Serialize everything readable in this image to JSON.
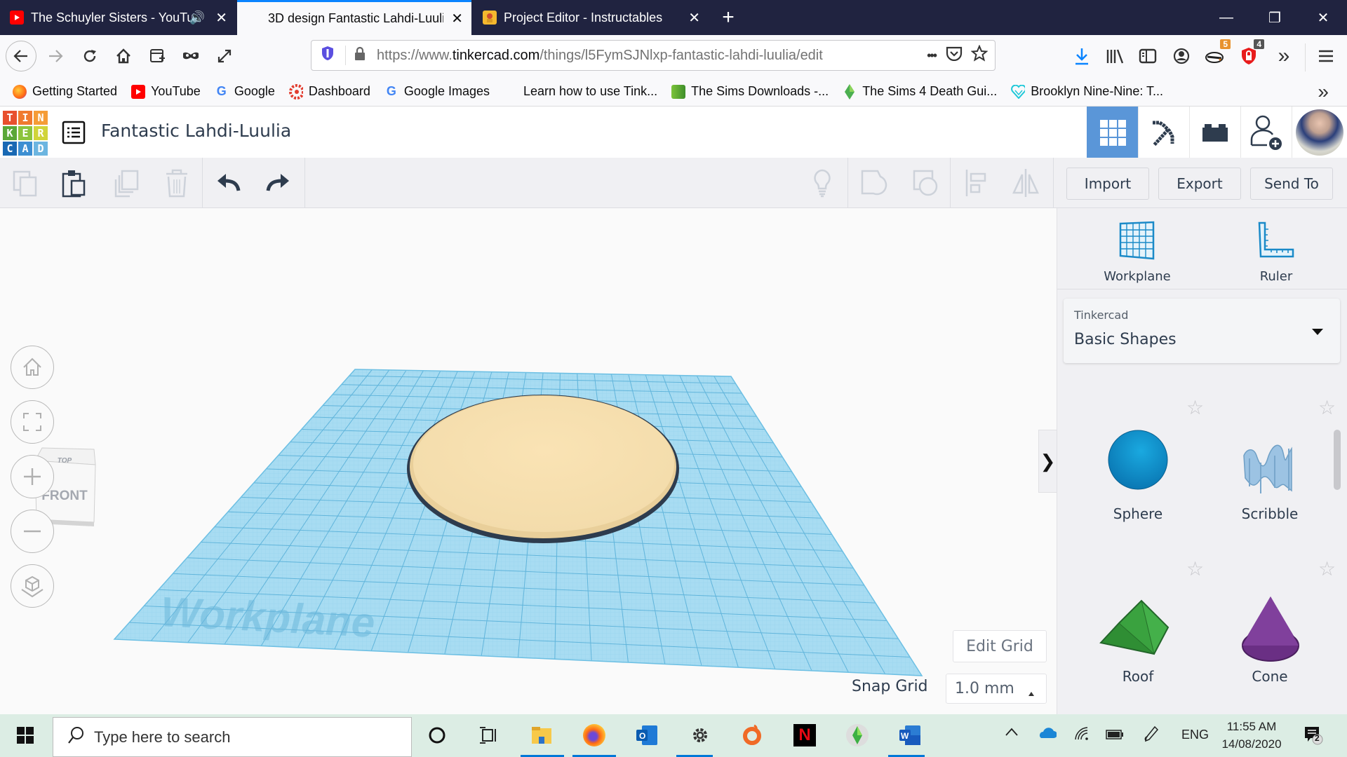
{
  "browser": {
    "tabs": [
      {
        "title": "The Schuyler Sisters - YouTu",
        "icon": "youtube-icon",
        "audio": true,
        "active": false
      },
      {
        "title": "3D design Fantastic Lahdi-Luuli",
        "icon": "tinkercad-icon",
        "active": true
      },
      {
        "title": "Project Editor - Instructables",
        "icon": "instructables-icon",
        "active": false
      }
    ],
    "new_tab": "+",
    "window_controls": {
      "minimize": "—",
      "restore": "❐",
      "close": "✕"
    },
    "url": {
      "prefix": "https://www.",
      "domain": "tinkercad.com",
      "path": "/things/l5FymSJNlxp-fantastic-lahdi-luulia/edit"
    },
    "url_more": "•••",
    "badges": {
      "extension_1": "5",
      "extension_2": "4"
    },
    "overflow": "»",
    "bookmarks": [
      {
        "label": "Getting Started",
        "icon": "firefox-icon"
      },
      {
        "label": "YouTube",
        "icon": "youtube-icon"
      },
      {
        "label": "Google",
        "icon": "google-icon"
      },
      {
        "label": "Dashboard",
        "icon": "canvas-icon"
      },
      {
        "label": "Google Images",
        "icon": "google-icon"
      },
      {
        "label": "Learn how to use Tink...",
        "icon": "tinkercad-icon"
      },
      {
        "label": "The Sims Downloads -...",
        "icon": "sims-icon"
      },
      {
        "label": "The Sims 4 Death Gui...",
        "icon": "plumbob-icon"
      },
      {
        "label": "Brooklyn Nine-Nine: T...",
        "icon": "heart-icon"
      }
    ],
    "bookmarks_overflow": "»"
  },
  "app": {
    "logo_letters": [
      "T",
      "I",
      "N",
      "K",
      "E",
      "R",
      "C",
      "A",
      "D"
    ],
    "logo_colors": [
      "#e8502e",
      "#f07a2e",
      "#f59c36",
      "#5aa738",
      "#8cc43d",
      "#d0d43a",
      "#1969b4",
      "#3d8fd2",
      "#6cb5e0"
    ],
    "design_title": "Fantastic Lahdi-Luulia",
    "accent": "#5a96d8",
    "toolbar": {
      "import": "Import",
      "export": "Export",
      "send_to": "Send To"
    },
    "viewcube": {
      "top": "TOP",
      "front": "FRONT"
    },
    "workplane_label": "Workplane",
    "edit_grid": "Edit Grid",
    "snap_grid_label": "Snap Grid",
    "snap_grid_value": "1.0 mm",
    "panel": {
      "workplane": "Workplane",
      "ruler": "Ruler",
      "library_source": "Tinkercad",
      "library_name": "Basic Shapes",
      "collapse": "❯",
      "shapes": [
        {
          "name": "Sphere",
          "color": "#0a8ed0"
        },
        {
          "name": "Scribble",
          "color": "#9cc3e3"
        },
        {
          "name": "Roof",
          "color": "#3ea93c"
        },
        {
          "name": "Cone",
          "color": "#7b3a96"
        }
      ]
    }
  },
  "taskbar": {
    "search_placeholder": "Type here to search",
    "language": "ENG",
    "time": "11:55 AM",
    "date": "14/08/2020",
    "notifications": "2"
  }
}
